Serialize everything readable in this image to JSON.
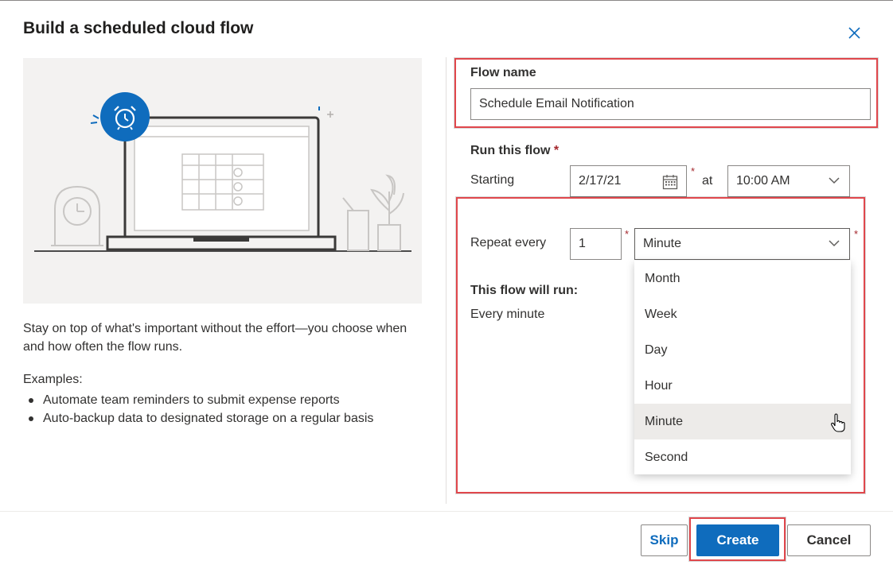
{
  "dialog": {
    "title": "Build a scheduled cloud flow"
  },
  "left": {
    "description": "Stay on top of what's important without the effort—you choose when and how often the flow runs.",
    "examples_title": "Examples:",
    "examples": [
      "Automate team reminders to submit expense reports",
      "Auto-backup data to designated storage on a regular basis"
    ]
  },
  "form": {
    "flow_name_label": "Flow name",
    "flow_name_value": "Schedule Email Notification",
    "run_label": "Run this flow",
    "required_star": "*",
    "starting_label": "Starting",
    "date_value": "2/17/21",
    "at_label": "at",
    "time_value": "10:00 AM",
    "repeat_label": "Repeat every",
    "repeat_value": "1",
    "unit_value": "Minute",
    "will_run_label": "This flow will run:",
    "will_run_value": "Every minute"
  },
  "unit_options": [
    {
      "label": "Month"
    },
    {
      "label": "Week"
    },
    {
      "label": "Day"
    },
    {
      "label": "Hour"
    },
    {
      "label": "Minute",
      "selected": true
    },
    {
      "label": "Second"
    }
  ],
  "footer": {
    "skip": "Skip",
    "create": "Create",
    "cancel": "Cancel"
  },
  "colors": {
    "accent": "#0f6cbd",
    "highlight": "#e0474c",
    "required": "#a4262c",
    "alarm_badge": "#0f6cbd"
  }
}
